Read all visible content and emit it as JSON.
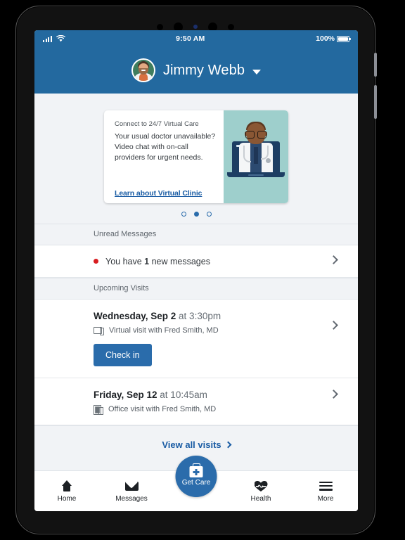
{
  "status_bar": {
    "signal_icon": "cellular-signal-icon",
    "wifi_icon": "wifi-icon",
    "time": "9:50 AM",
    "battery_percent": "100%",
    "battery_icon": "battery-full-icon"
  },
  "header": {
    "avatar_icon": "user-avatar",
    "user_name": "Jimmy Webb",
    "caret_icon": "chevron-down-icon",
    "background_color": "#23699f"
  },
  "promo_card": {
    "eyebrow": "Connect to 24/7 Virtual Care",
    "body": "Your usual doctor unavailable? Video chat with on-call providers for urgent needs.",
    "link_label": "Learn about Virtual Clinic",
    "illustration_icon": "doctor-video-visit-illustration",
    "illustration_bg_color": "#9ecfcc",
    "link_color": "#1a5ca4",
    "carousel": {
      "total": 3,
      "active_index": 1
    }
  },
  "unread_messages": {
    "section_title": "Unread Messages",
    "dot_color": "#d81c20",
    "text_prefix": "You have ",
    "count": "1",
    "text_suffix": " new messages",
    "chevron_icon": "chevron-right-icon"
  },
  "upcoming_visits": {
    "section_title": "Upcoming Visits",
    "visits": [
      {
        "date": "Wednesday, Sep 2",
        "time": " at 3:30pm",
        "type_icon": "monitor-icon",
        "detail": "Virtual visit with Fred Smith, MD",
        "action_label": "Check in",
        "chevron_icon": "chevron-right-icon"
      },
      {
        "date": "Friday, Sep 12",
        "time": " at 10:45am",
        "type_icon": "building-icon",
        "detail": "Office visit with Fred Smith, MD",
        "chevron_icon": "chevron-right-icon"
      }
    ],
    "view_all_label": "View all visits"
  },
  "bottom_nav": {
    "items": [
      {
        "label": "Home",
        "icon": "home-icon"
      },
      {
        "label": "Messages",
        "icon": "envelope-icon"
      },
      {
        "label": "Health",
        "icon": "heart-pulse-icon"
      },
      {
        "label": "More",
        "icon": "hamburger-menu-icon"
      }
    ],
    "get_care": {
      "label": "Get Care",
      "icon": "medical-bag-icon",
      "color": "#2b6cab"
    }
  },
  "theme": {
    "brand_blue": "#23699f",
    "button_blue": "#2a6cab",
    "page_bg": "#f1f3f6"
  }
}
